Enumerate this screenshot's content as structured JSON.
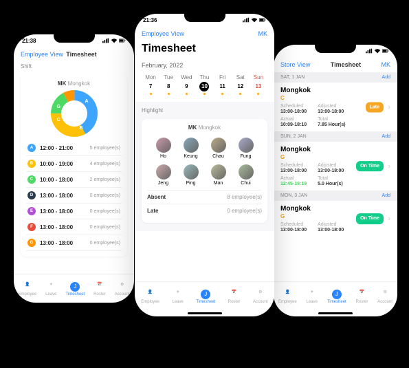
{
  "phone_left": {
    "time": "21:38",
    "header": {
      "link": "Employee View",
      "title": "Timesheet"
    },
    "section": "Shift",
    "chart_title_mk": "MK",
    "chart_title_name": "Mongkok",
    "shifts": [
      {
        "letter": "A",
        "color": "#3ea5ff",
        "time": "12:00 - 21:00",
        "emp": "5 employee(s)"
      },
      {
        "letter": "B",
        "color": "#ffc107",
        "time": "10:00 - 19:00",
        "emp": "4 employee(s)"
      },
      {
        "letter": "C",
        "color": "#4cd964",
        "time": "10:00 - 18:00",
        "emp": "2 employee(s)"
      },
      {
        "letter": "D",
        "color": "#2c3e50",
        "time": "13:00 - 18:00",
        "emp": "0 employee(s)"
      },
      {
        "letter": "E",
        "color": "#b24fd8",
        "time": "13:00 - 18:00",
        "emp": "0 employee(s)"
      },
      {
        "letter": "F",
        "color": "#e74c3c",
        "time": "13:00 - 18:00",
        "emp": "0 employee(s)"
      },
      {
        "letter": "G",
        "color": "#ff9500",
        "time": "13:00 - 18:00",
        "emp": "0 employee(s)"
      }
    ]
  },
  "phone_center": {
    "time": "21:36",
    "header": {
      "link": "Employee View",
      "badge": "MK"
    },
    "title": "Timesheet",
    "month": "February, 2022",
    "days": [
      {
        "name": "Mon",
        "num": "7"
      },
      {
        "name": "Tue",
        "num": "8"
      },
      {
        "name": "Wed",
        "num": "9"
      },
      {
        "name": "Thu",
        "num": "10",
        "today": true
      },
      {
        "name": "Fri",
        "num": "11"
      },
      {
        "name": "Sat",
        "num": "12"
      },
      {
        "name": "Sun",
        "num": "13",
        "sun": true
      }
    ],
    "highlight_label": "Highlight",
    "chart_title_mk": "MK",
    "chart_title_name": "Mongkok",
    "people": [
      "Ho",
      "Keung",
      "Chau",
      "Fung",
      "Jeng",
      "Ping",
      "Man",
      "Chui"
    ],
    "summary": [
      {
        "label": "Absent",
        "value": "8 employee(s)"
      },
      {
        "label": "Late",
        "value": "0 employee(s)"
      }
    ]
  },
  "phone_right": {
    "header": {
      "link": "Store View",
      "title": "Timesheet",
      "badge": "MK"
    },
    "add": "Add",
    "records": [
      {
        "date": "SAT, 1 JAN",
        "loc": "Mongkok",
        "code": "C",
        "codeClass": "",
        "sched": "13:00-18:00",
        "adj": "13:00-18:00",
        "actual": "10:09-18:10",
        "actualClass": "",
        "total": "7.85 Hour(s)",
        "badge": "Late",
        "badgeClass": "late"
      },
      {
        "date": "SUN, 2 JAN",
        "loc": "Mongkok",
        "code": "G",
        "codeClass": "",
        "sched": "13:00-18:00",
        "adj": "13:00-18:00",
        "actual": "12:45-18:19",
        "actualClass": "green",
        "total": "5.0 Hour(s)",
        "badge": "On\nTime",
        "badgeClass": "ontime"
      },
      {
        "date": "MON, 3 JAN",
        "loc": "Mongkok",
        "code": "G",
        "codeClass": "",
        "sched": "13:00-18:00",
        "adj": "13:00-18:00",
        "actual": "",
        "actualClass": "",
        "total": "",
        "badge": "On\nTime",
        "badgeClass": "ontime"
      }
    ]
  },
  "tabs": [
    "Employee",
    "Leave",
    "Timesheet",
    "Roster",
    "Account"
  ],
  "labels": {
    "scheduled": "Scheduled",
    "adjusted": "Adjusted",
    "actual": "Actual",
    "total": "Total"
  },
  "chart_data": {
    "type": "pie",
    "title": "MK Mongkok",
    "categories": [
      "A",
      "B",
      "C",
      "G"
    ],
    "values": [
      5,
      4,
      2,
      1
    ],
    "colors": [
      "#3ea5ff",
      "#ffc107",
      "#4cd964",
      "#ff9500"
    ]
  }
}
